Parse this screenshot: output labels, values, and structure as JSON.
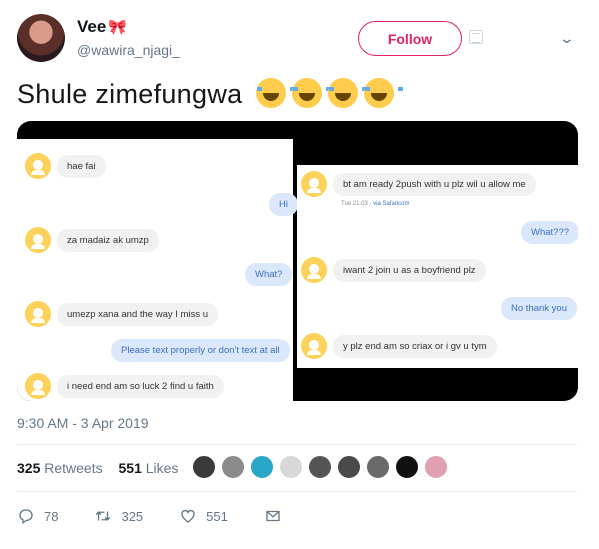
{
  "author": {
    "name": "Vee",
    "name_emoji": "🎀",
    "handle": "@wawira_njagi_",
    "follow_label": "Follow"
  },
  "tweet": {
    "text": "Shule zimefungwa",
    "emoji_count": 4,
    "timestamp": "9:30 AM - 3 Apr 2019"
  },
  "media": {
    "left_chat": [
      {
        "side": "in",
        "text": "hae fai"
      },
      {
        "side": "out",
        "text": "Hi"
      },
      {
        "side": "in",
        "text": "za madaiz ak umzp"
      },
      {
        "side": "out",
        "text": "What?"
      },
      {
        "side": "in",
        "text": "umezp xana and the way  I miss u"
      },
      {
        "side": "out",
        "text": "Please text properly or don't text at all"
      },
      {
        "side": "in",
        "text": "i need end am so luck 2 find u faith"
      }
    ],
    "right_chat": [
      {
        "side": "in",
        "text": "bt am ready 2push with u plz wil u allow me"
      },
      {
        "side": "out",
        "text": "What???"
      },
      {
        "side": "in",
        "text": "iwant 2 join u as a boyfriend  plz"
      },
      {
        "side": "out",
        "text": "No thank you"
      },
      {
        "side": "in",
        "text": "y plz end am so criax or i gv u tym"
      }
    ],
    "right_time": "Tue 21.03 · ",
    "right_via": "via Safaricom"
  },
  "stats": {
    "retweets_count": "325",
    "retweets_label": "Retweets",
    "likes_count": "551",
    "likes_label": "Likes",
    "liker_colors": [
      "#3a3a3a",
      "#8a8a8a",
      "#2aa6c7",
      "#d8d8d8",
      "#555555",
      "#4a4a4a",
      "#6a6a6a",
      "#111111",
      "#e0a0b0"
    ]
  },
  "actions": {
    "replies": "78",
    "retweets": "325",
    "likes": "551"
  },
  "colors": {
    "accent": "#e0245e",
    "muted": "#657786",
    "bubble_out": "#dbe8fb",
    "face": "#fdd25a"
  }
}
